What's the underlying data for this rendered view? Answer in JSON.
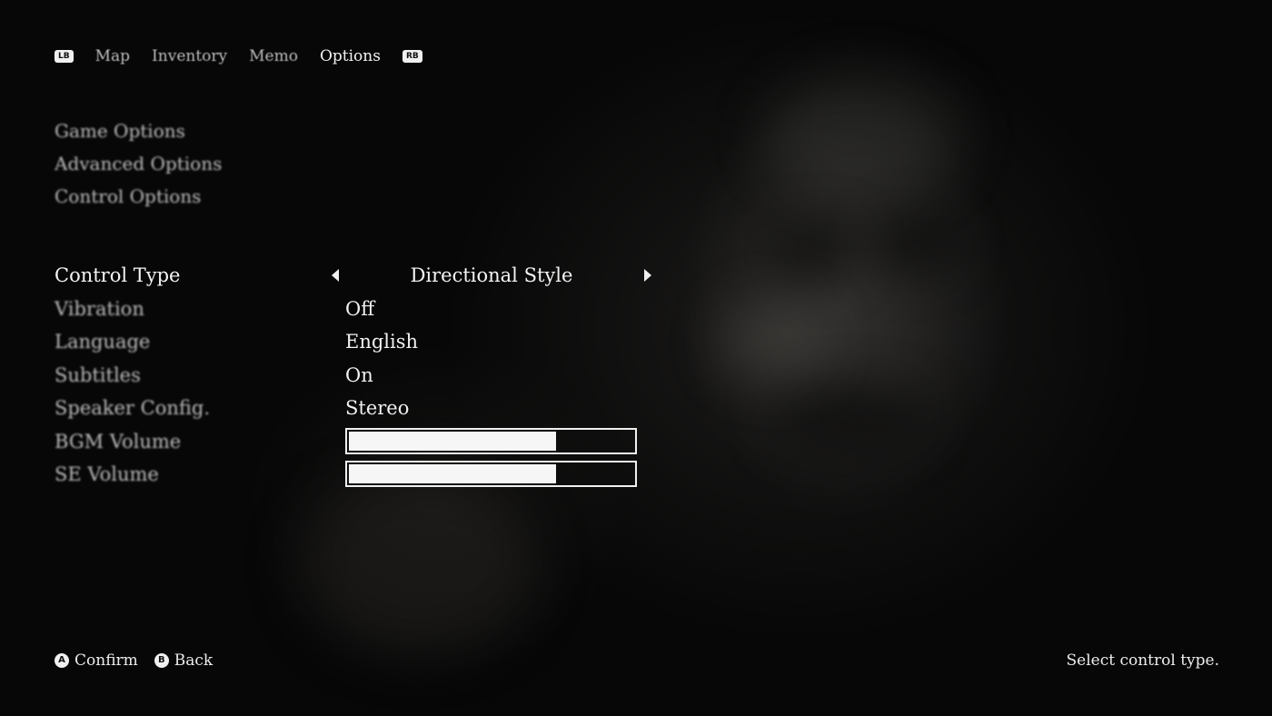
{
  "topnav": {
    "left_bumper": "LB",
    "right_bumper": "RB",
    "tabs": [
      {
        "label": "Map"
      },
      {
        "label": "Inventory"
      },
      {
        "label": "Memo"
      },
      {
        "label": "Options"
      }
    ],
    "active_tab": "Options"
  },
  "submenu": {
    "items": [
      {
        "label": "Game Options"
      },
      {
        "label": "Advanced Options"
      },
      {
        "label": "Control Options"
      }
    ]
  },
  "settings": {
    "control_type": {
      "label": "Control Type",
      "value": "Directional Style"
    },
    "vibration": {
      "label": "Vibration",
      "value": "Off"
    },
    "language": {
      "label": "Language",
      "value": "English"
    },
    "subtitles": {
      "label": "Subtitles",
      "value": "On"
    },
    "speaker_config": {
      "label": "Speaker Config.",
      "value": "Stereo"
    },
    "bgm_volume": {
      "label": "BGM Volume",
      "level_percent": 73
    },
    "se_volume": {
      "label": "SE Volume",
      "level_percent": 73
    }
  },
  "footer": {
    "confirm": {
      "glyph": "A",
      "label": "Confirm"
    },
    "back": {
      "glyph": "B",
      "label": "Back"
    },
    "help_text": "Select control type."
  },
  "colors": {
    "background": "#050505",
    "text_active": "#f4f4f4",
    "text_inactive": "#bdbdbd",
    "slider_fill": "#f6f6f6"
  }
}
